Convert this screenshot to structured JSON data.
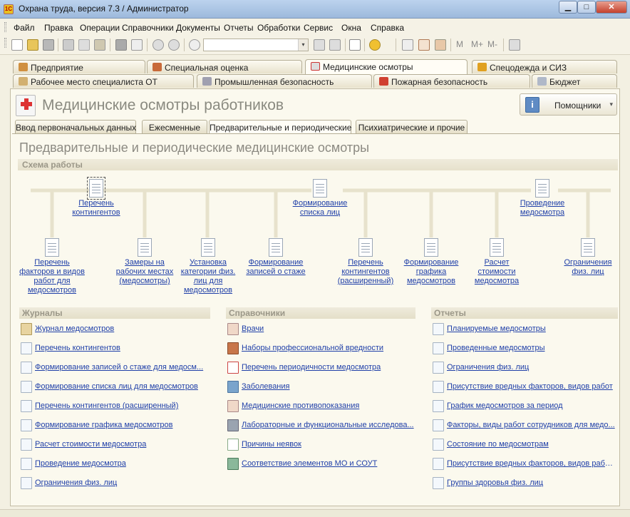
{
  "window": {
    "title": "Охрана труда, версия 7.3 / Администратор",
    "app_icon": "1С",
    "min_glyph": "▁",
    "max_glyph": "□",
    "close_glyph": "✕"
  },
  "menu": [
    "Файл",
    "Правка",
    "Операции",
    "Справочники",
    "Документы",
    "Отчеты",
    "Обработки",
    "Сервис",
    "Окна",
    "Справка"
  ],
  "toolbar": {
    "m": "M",
    "mplus": "M+",
    "mminus": "M-",
    "combo_arrow": "▾"
  },
  "main_tabs_row1": [
    "Предприятие",
    "Специальная оценка",
    "Медицинские осмотры",
    "Спецодежда и СИЗ"
  ],
  "main_tabs_row2": [
    "Рабочее место специалиста ОТ",
    "Промышленная безопасность",
    "Пожарная безопасность",
    "Бюджет"
  ],
  "page": {
    "title": "Медицинские осмотры работников",
    "helpers_label": "Помощники",
    "helpers_icon": "i",
    "helpers_arrow": "▾"
  },
  "sub_tabs": [
    "Ввод первоначальных данных",
    "Ежесменные",
    "Предварительные и периодические",
    "Психиатрические и прочие"
  ],
  "section_title": "Предварительные и периодические медицинские осмотры",
  "scheme": {
    "label": "Схема работы",
    "top": [
      "Перечень контингентов",
      "Формирование списка лиц",
      "Проведение медосмотра"
    ],
    "bottom": [
      "Перечень факторов и видов работ для медосмотров",
      "Замеры на рабочих местах (медосмотры)",
      "Установка категории физ. лиц для медосмотров",
      "Формирование записей о стаже",
      "Перечень контингентов (расширенный)",
      "Формирование графика медосмотров",
      "Расчет стоимости медосмотра",
      "Ограничения физ. лиц"
    ]
  },
  "journals": {
    "title": "Журналы",
    "items": [
      "Журнал медосмотров",
      "Перечень контингентов",
      "Формирование записей о стаже для медосм...",
      "Формирование списка лиц для медосмотров",
      "Перечень контингентов (расширенный)",
      "Формирование графика медосмотров",
      "Расчет стоимости медосмотра",
      "Проведение медосмотра",
      "Ограничения физ. лиц"
    ]
  },
  "directories": {
    "title": "Справочники",
    "items": [
      "Врачи",
      "Наборы профессиональной вредности",
      "Перечень периодичности медосмотра",
      "Заболевания",
      "Медицинские противопоказания",
      "Лабораторные и функциональные исследова...",
      "Причины неявок",
      "Соответствие элементов МО и СОУТ"
    ]
  },
  "reports": {
    "title": "Отчеты",
    "items": [
      "Планируемые медосмотры",
      "Проведенные медосмотры",
      "Ограничения физ. лиц",
      "Присутствие вредных факторов, видов работ",
      "График медосмотров за период",
      "Факторы, виды работ сотрудников для медо...",
      "Состояние по медосмотрам",
      "Присутствие вредных факторов, видов работ...",
      "Группы здоровья физ. лиц"
    ]
  }
}
